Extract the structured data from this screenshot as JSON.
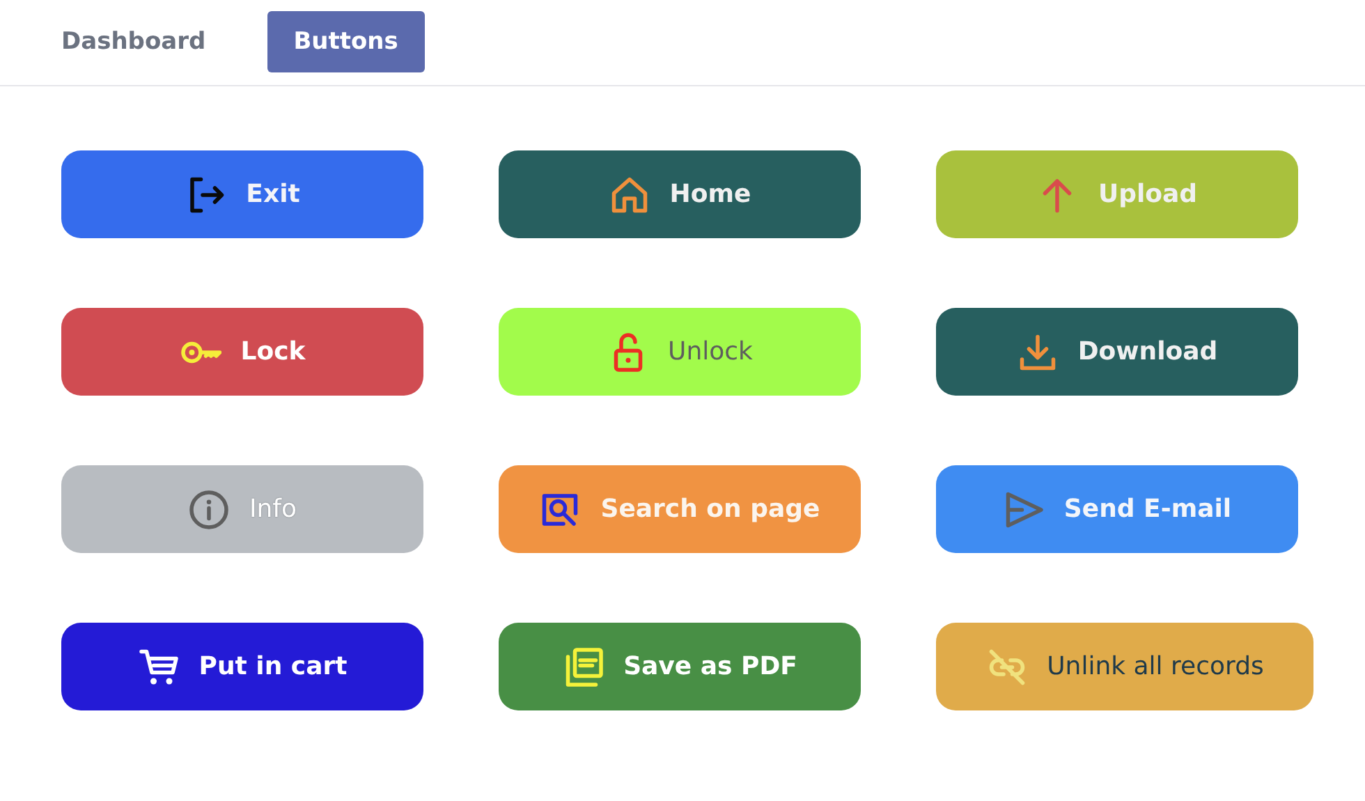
{
  "tabs": [
    {
      "label": "Dashboard",
      "selected": false
    },
    {
      "label": "Buttons",
      "selected": true
    }
  ],
  "buttons": [
    {
      "label": "Exit",
      "kind": "exit",
      "color": "#356ced",
      "disabled": false
    },
    {
      "label": "Home",
      "kind": "home",
      "color": "#275f5f",
      "disabled": false
    },
    {
      "label": "Upload",
      "kind": "upload",
      "color": "#a9c13d",
      "disabled": false
    },
    {
      "label": "Lock",
      "kind": "key",
      "color": "#d04c52",
      "disabled": false
    },
    {
      "label": "Unlock",
      "kind": "unlock",
      "color": "#a2fb4b",
      "disabled": false
    },
    {
      "label": "Download",
      "kind": "download",
      "color": "#275f5f",
      "disabled": false
    },
    {
      "label": "Info",
      "kind": "info",
      "color": "#b8bcc1",
      "disabled": true
    },
    {
      "label": "Search on page",
      "kind": "search",
      "color": "#f09342",
      "disabled": false
    },
    {
      "label": "Send E-mail",
      "kind": "send",
      "color": "#3f8cf2",
      "disabled": false
    },
    {
      "label": "Put in cart",
      "kind": "cart",
      "color": "#241bd6",
      "disabled": false
    },
    {
      "label": "Save as PDF",
      "kind": "pdf",
      "color": "#488f45",
      "disabled": false
    },
    {
      "label": "Unlink all records",
      "kind": "unlink",
      "color": "#e0ab4a",
      "disabled": false
    }
  ]
}
